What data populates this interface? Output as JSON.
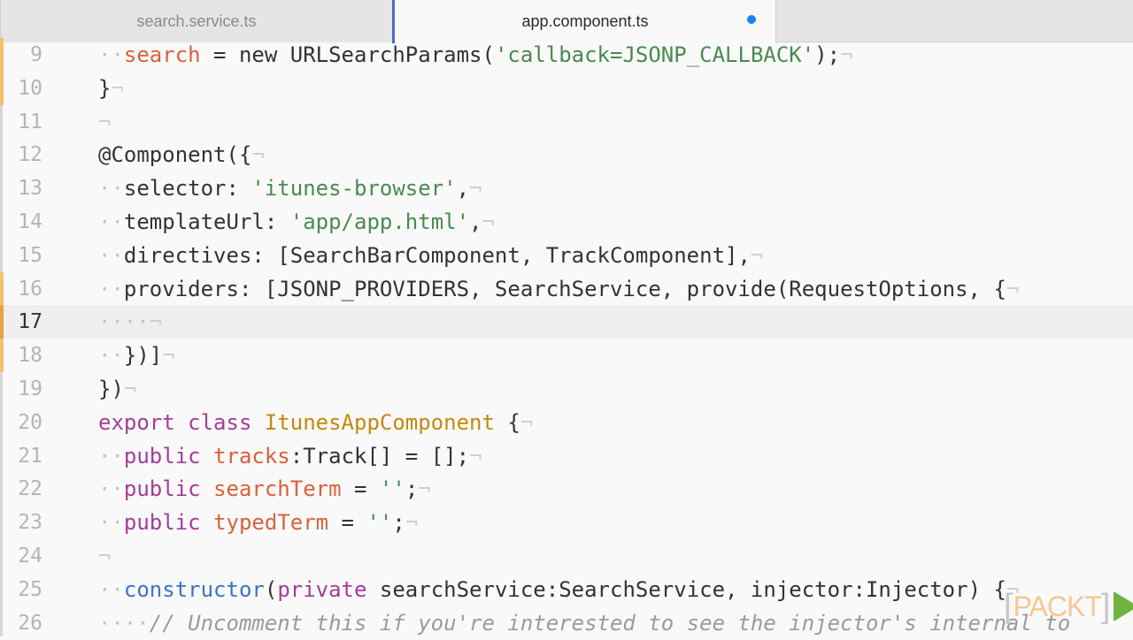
{
  "tabs": [
    {
      "label": "search.service.ts",
      "active": false,
      "modified": false
    },
    {
      "label": "app.component.ts",
      "active": true,
      "modified": true
    }
  ],
  "colors": {
    "accent_tab_border": "#4a6bc8",
    "modified_dot": "#1a84f0",
    "gutter_change": "#f0c36d",
    "string": "#4a8a4e",
    "keyword": "#a53d9a",
    "variable": "#d9613c",
    "class_name": "#c38a0c",
    "function": "#3b73c9",
    "comment": "#9b9b9b"
  },
  "editor": {
    "current_line": 17,
    "lines": [
      {
        "n": "9",
        "mark": "change",
        "tokens": [
          [
            "ws",
            "··"
          ],
          [
            "var",
            "search"
          ],
          [
            "plain",
            " = new URLSearchParams("
          ],
          [
            "str",
            "'callback=JSONP_CALLBACK'"
          ],
          [
            "plain",
            ");"
          ],
          [
            "eol",
            "¬"
          ]
        ]
      },
      {
        "n": "10",
        "mark": "change",
        "tokens": [
          [
            "plain",
            "}"
          ],
          [
            "eol",
            "¬"
          ]
        ]
      },
      {
        "n": "11",
        "mark": "",
        "tokens": [
          [
            "eol",
            "¬"
          ]
        ]
      },
      {
        "n": "12",
        "mark": "",
        "tokens": [
          [
            "plain",
            "@Component({"
          ],
          [
            "eol",
            "¬"
          ]
        ]
      },
      {
        "n": "13",
        "mark": "",
        "tokens": [
          [
            "ws",
            "··"
          ],
          [
            "plain",
            "selector: "
          ],
          [
            "str",
            "'itunes-browser'"
          ],
          [
            "plain",
            ","
          ],
          [
            "eol",
            "¬"
          ]
        ]
      },
      {
        "n": "14",
        "mark": "",
        "tokens": [
          [
            "ws",
            "··"
          ],
          [
            "plain",
            "templateUrl: "
          ],
          [
            "str",
            "'app/app.html'"
          ],
          [
            "plain",
            ","
          ],
          [
            "eol",
            "¬"
          ]
        ]
      },
      {
        "n": "15",
        "mark": "",
        "tokens": [
          [
            "ws",
            "··"
          ],
          [
            "plain",
            "directives: [SearchBarComponent, TrackComponent],"
          ],
          [
            "eol",
            "¬"
          ]
        ]
      },
      {
        "n": "16",
        "mark": "change",
        "tokens": [
          [
            "ws",
            "··"
          ],
          [
            "plain",
            "providers: [JSONP_PROVIDERS, SearchService, provide(RequestOptions, {"
          ],
          [
            "eol",
            "¬"
          ]
        ]
      },
      {
        "n": "17",
        "mark": "strong",
        "tokens": [
          [
            "ws",
            "····"
          ],
          [
            "eol",
            "¬"
          ]
        ]
      },
      {
        "n": "18",
        "mark": "change",
        "tokens": [
          [
            "ws",
            "··"
          ],
          [
            "plain",
            "})]"
          ],
          [
            "eol",
            "¬"
          ]
        ]
      },
      {
        "n": "19",
        "mark": "",
        "tokens": [
          [
            "plain",
            "})"
          ],
          [
            "eol",
            "¬"
          ]
        ]
      },
      {
        "n": "20",
        "mark": "",
        "tokens": [
          [
            "kw",
            "export class "
          ],
          [
            "cls",
            "ItunesAppComponent"
          ],
          [
            "plain",
            " {"
          ],
          [
            "eol",
            "¬"
          ]
        ]
      },
      {
        "n": "21",
        "mark": "",
        "tokens": [
          [
            "ws",
            "··"
          ],
          [
            "kw",
            "public "
          ],
          [
            "var",
            "tracks"
          ],
          [
            "plain",
            ":Track[] = [];"
          ],
          [
            "eol",
            "¬"
          ]
        ]
      },
      {
        "n": "22",
        "mark": "",
        "tokens": [
          [
            "ws",
            "··"
          ],
          [
            "kw",
            "public "
          ],
          [
            "var",
            "searchTerm"
          ],
          [
            "plain",
            " = "
          ],
          [
            "str",
            "''"
          ],
          [
            "plain",
            ";"
          ],
          [
            "eol",
            "¬"
          ]
        ]
      },
      {
        "n": "23",
        "mark": "",
        "tokens": [
          [
            "ws",
            "··"
          ],
          [
            "kw",
            "public "
          ],
          [
            "var",
            "typedTerm"
          ],
          [
            "plain",
            " = "
          ],
          [
            "str",
            "''"
          ],
          [
            "plain",
            ";"
          ],
          [
            "eol",
            "¬"
          ]
        ]
      },
      {
        "n": "24",
        "mark": "",
        "tokens": [
          [
            "eol",
            "¬"
          ]
        ]
      },
      {
        "n": "25",
        "mark": "",
        "tokens": [
          [
            "ws",
            "··"
          ],
          [
            "fn",
            "constructor"
          ],
          [
            "plain",
            "("
          ],
          [
            "kw",
            "private "
          ],
          [
            "plain",
            "searchService:SearchService, injector:Injector) {"
          ],
          [
            "eol",
            "¬"
          ]
        ]
      },
      {
        "n": "26",
        "mark": "",
        "tokens": [
          [
            "ws",
            "····"
          ],
          [
            "cmt",
            "// Uncomment this if you're interested to see the injector's internal to"
          ]
        ]
      }
    ]
  },
  "watermark": {
    "left_bracket": "[",
    "text": "PACKT",
    "right_bracket": "]",
    "icon": "play-icon"
  }
}
